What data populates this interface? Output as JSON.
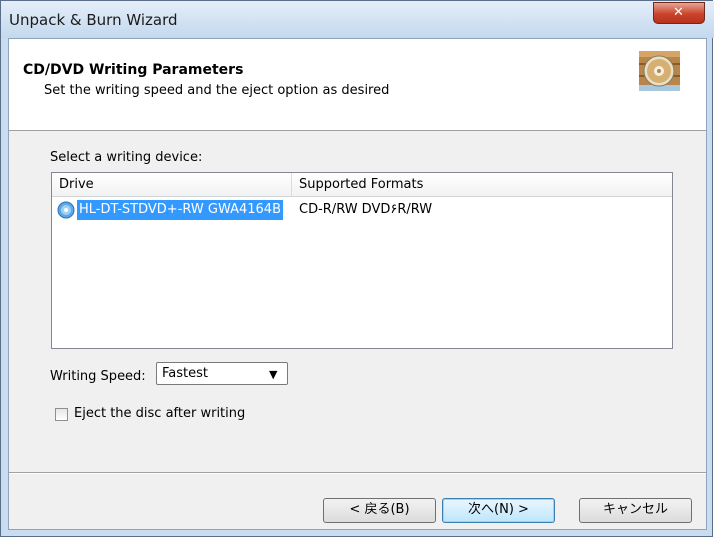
{
  "window": {
    "title": "Unpack & Burn Wizard"
  },
  "header": {
    "title": "CD/DVD Writing Parameters",
    "subtitle": "Set the writing speed and the eject option as desired"
  },
  "device": {
    "label": "Select a writing device:",
    "columns": [
      "Drive",
      "Supported Formats"
    ],
    "rows": [
      {
        "drive": "HL-DT-STDVD+-RW GWA4164B",
        "formats": "CD-R/RW DVD۶R/RW",
        "selected": true
      }
    ]
  },
  "speed": {
    "label": "Writing Speed:",
    "value": "Fastest"
  },
  "eject": {
    "label": "Eject the disc after writing",
    "checked": false
  },
  "buttons": {
    "back": "< 戻る(B)",
    "next": "次へ(N) >",
    "cancel": "キャンセル"
  },
  "icons": {
    "close": "close-icon",
    "wizard": "disc-burn-icon",
    "drive": "cd-drive-icon",
    "dropdown": "chevron-down-icon"
  },
  "colors": {
    "selection": "#3399ff",
    "close": "#c9442b"
  }
}
